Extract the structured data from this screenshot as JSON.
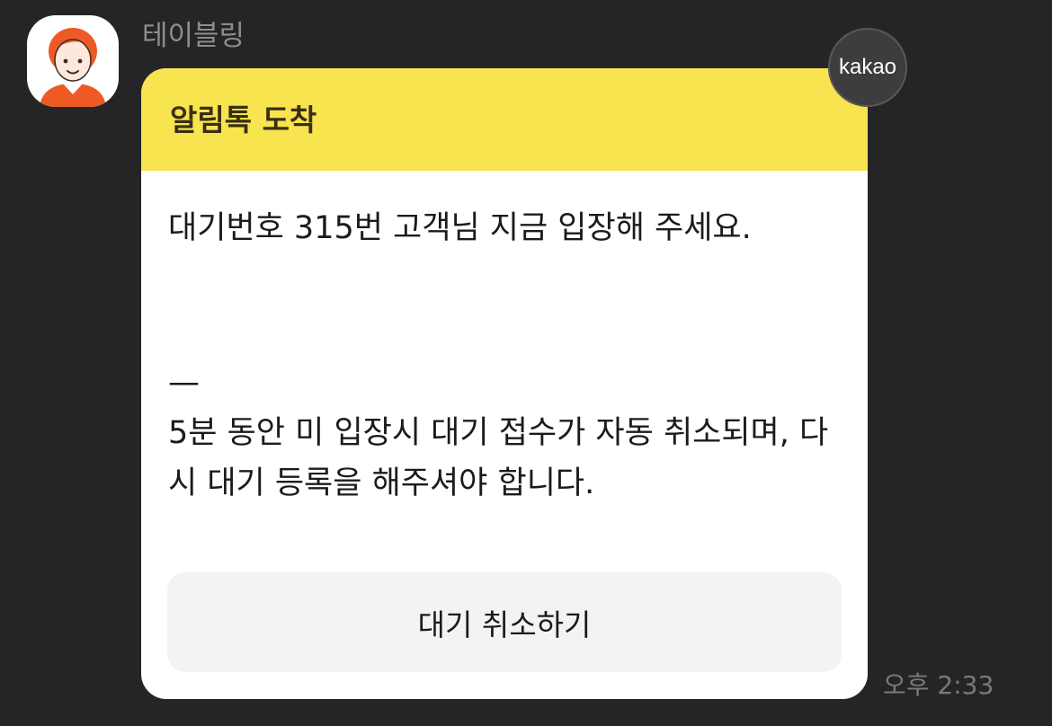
{
  "sender": {
    "name": "테이블링",
    "avatar_icon": "person-avatar-icon"
  },
  "message": {
    "header_title": "알림톡 도착",
    "header_color": "#f7e44e",
    "body_main": "대기번호 315번 고객님 지금 입장해 주세요.",
    "divider": "—",
    "body_notice": "5분 동안 미 입장시 대기 접수가 자동 취소되며, 다시 대기 등록을 해주셔야 합니다.",
    "button_label": "대기 취소하기",
    "timestamp": "오후 2:33"
  },
  "badge": {
    "label": "kakao"
  },
  "colors": {
    "background": "#252527",
    "card": "#ffffff",
    "button": "#f3f3f3",
    "avatar_accent": "#ee5a24"
  }
}
